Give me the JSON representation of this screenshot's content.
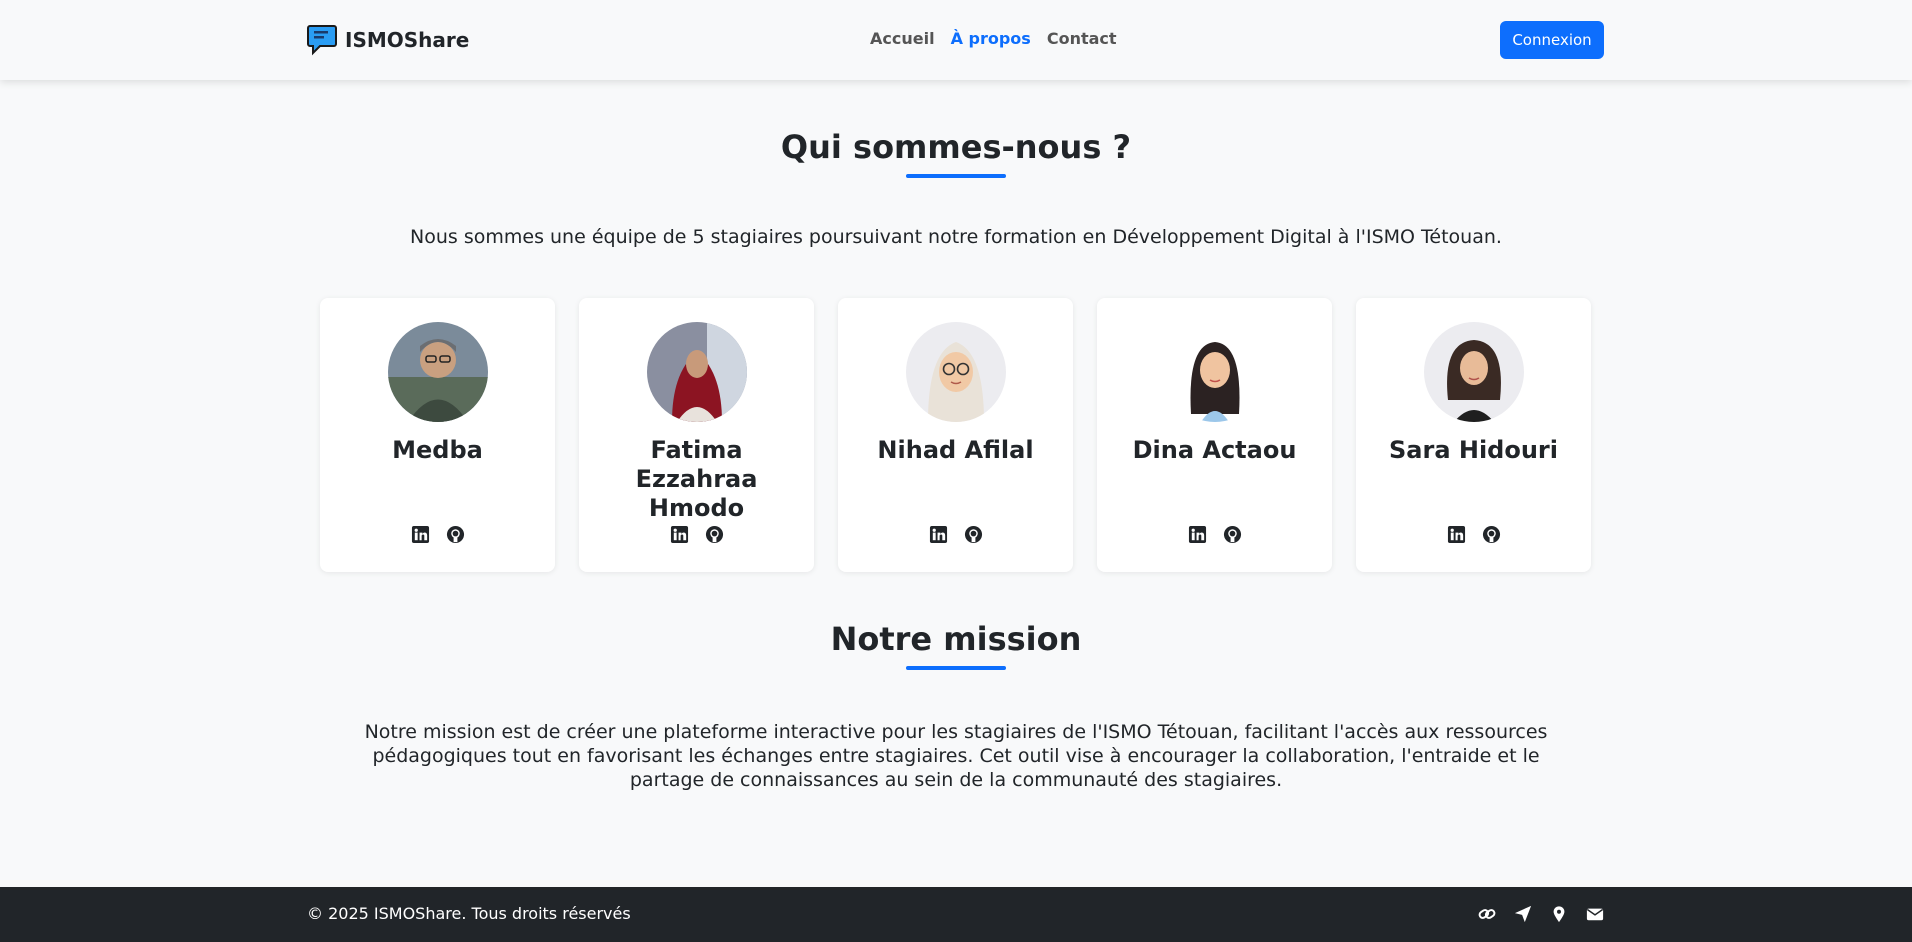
{
  "navbar": {
    "brand": "ISMOShare",
    "brand_icon": "chat-bubble-icon",
    "links": [
      {
        "label": "Accueil",
        "active": false
      },
      {
        "label": "À propos",
        "active": true
      },
      {
        "label": "Contact",
        "active": false
      }
    ],
    "login_label": "Connexion"
  },
  "about": {
    "title": "Qui sommes-nous ?",
    "intro": "Nous sommes une équipe de 5 stagiaires poursuivant notre formation en Développement Digital à l'ISMO Tétouan."
  },
  "team": [
    {
      "name": "Medba",
      "socials": [
        "linkedin-icon",
        "github-icon"
      ]
    },
    {
      "name": "Fatima Ezzahraa Hmodo",
      "socials": [
        "linkedin-icon",
        "github-icon"
      ]
    },
    {
      "name": "Nihad Afilal",
      "socials": [
        "linkedin-icon",
        "github-icon"
      ]
    },
    {
      "name": "Dina Actaou",
      "socials": [
        "linkedin-icon",
        "github-icon"
      ]
    },
    {
      "name": "Sara Hidouri",
      "socials": [
        "linkedin-icon",
        "github-icon"
      ]
    }
  ],
  "mission": {
    "title": "Notre mission",
    "text": "Notre mission est de créer une plateforme interactive pour les stagiaires de l'ISMO Tétouan, facilitant l'accès aux ressources pédagogiques tout en favorisant les échanges entre stagiaires. Cet outil vise à encourager la collaboration, l'entraide et le partage de connaissances au sein de la communauté des stagiaires."
  },
  "footer": {
    "copyright": "© 2025 ISMOShare. Tous droits réservés",
    "icons": [
      "link-icon",
      "paper-plane-icon",
      "map-pin-icon",
      "envelope-icon"
    ]
  },
  "colors": {
    "accent": "#0d6efd",
    "background": "#f8f9fa",
    "footer": "#212529",
    "text": "#212529"
  }
}
